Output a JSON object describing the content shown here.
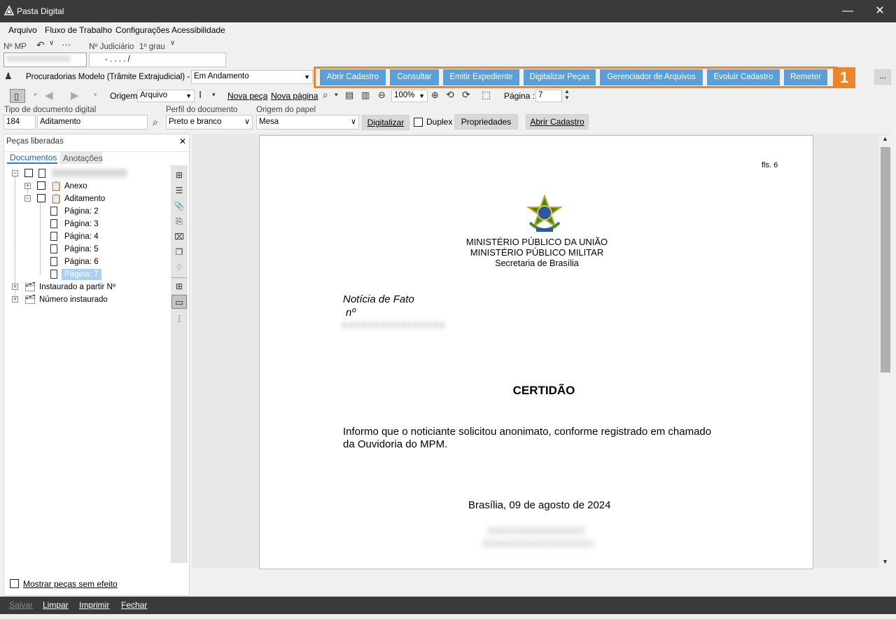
{
  "window": {
    "title": "Pasta Digital",
    "minimize": "—",
    "close": "✕"
  },
  "menu": [
    "Arquivo",
    "Fluxo de Trabalho",
    "Configurações",
    "Acessibilidade"
  ],
  "search": {
    "mp_label": "Nº MP",
    "judicial_label": "Nº Judiciário",
    "grau_label": "1º grau",
    "judicial_value": "- .     . . .    /"
  },
  "queue": {
    "label": "Procuradorias Modelo (Trâmite Extrajudicial) - Fila",
    "value": "Em Andamento"
  },
  "actions": [
    "Abrir Cadastro",
    "Consultar",
    "Emitir Expediente",
    "Digitalizar Peças",
    "Gerenciador de Arquivos",
    "Evoluir Cadastro",
    "Remeter"
  ],
  "badge": "1",
  "more_button": "...",
  "toolbar": {
    "origem_label": "Origem",
    "origem_value": "Arquivo",
    "nova_peca": "Nova peça",
    "nova_pagina": "Nova página",
    "zoom": "100%",
    "pagina_label": "Página :",
    "pagina_value": "7"
  },
  "scan": {
    "tipo_label": "Tipo de documento digital",
    "tipo_code": "184",
    "tipo_value": "Aditamento",
    "perfil_label": "Perfil do documento",
    "perfil_value": "Preto e branco",
    "origem_papel_label": "Origem do papel",
    "origem_papel_value": "Mesa",
    "digitalizar": "Digitalizar",
    "duplex": "Duplex",
    "propriedades": "Propriedades",
    "abrir_cadastro": "Abrir Cadastro"
  },
  "panel": {
    "title": "Peças liberadas",
    "close": "✕",
    "tabs": [
      "Documentos",
      "Anotações"
    ],
    "tree": {
      "root_blurred": "XXXXXXXXXXXXXX",
      "anexo": "Anexo",
      "aditamento": "Aditamento",
      "pages": [
        "Página: 2",
        "Página: 3",
        "Página: 4",
        "Página: 5",
        "Página: 6",
        "Página: 7"
      ],
      "instaurado": "Instaurado a partir Nº",
      "numero": "Número instaurado"
    },
    "show_no_effect": "Mostrar peças sem efeito"
  },
  "document": {
    "fls": "fls. 6",
    "org1": "MINISTÉRIO PÚBLICO DA UNIÃO",
    "org2": "MINISTÉRIO PÚBLICO MILITAR",
    "org3": "Secretaria de Brasília",
    "noticia1": "Notícia de Fato",
    "noticia2": "nº",
    "blur_number": "XXXXXXXXXXXXXXXX",
    "heading": "CERTIDÃO",
    "body1": "Informo que o noticiante solicitou anonimato, conforme registrado em chamado",
    "body2": "da Ouvidoria do MPM.",
    "date": "Brasília, 09 de agosto de 2024",
    "blur_sign1": "XXXXXXXXXXXXXXX",
    "blur_sign2": "XXXXXXXXXXXXXXXXX"
  },
  "bottom": [
    "Salvar",
    "Limpar",
    "Imprimir",
    "Fechar"
  ],
  "colors": {
    "accent": "#e9852b",
    "action_button": "#5a9fd8",
    "titlebar": "#3a3a3a"
  }
}
